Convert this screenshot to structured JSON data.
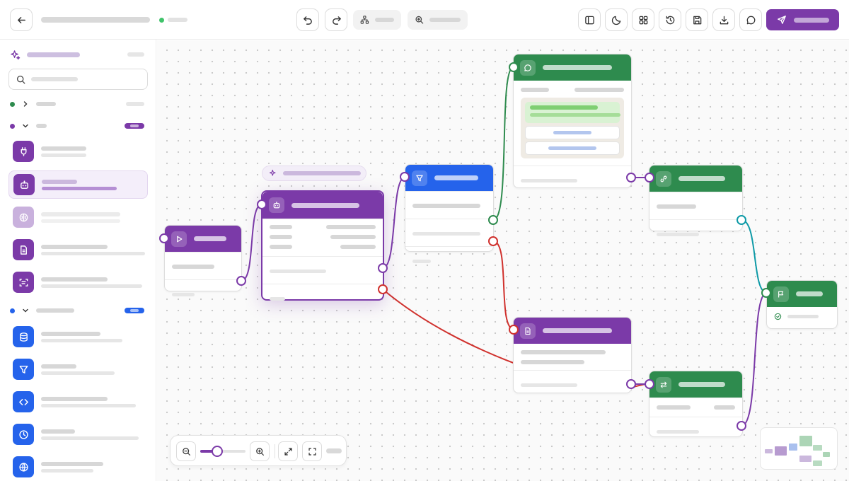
{
  "header": {
    "status_color": "#3fc36a",
    "back_icon": "arrow-left-icon",
    "undo_icon": "undo-icon",
    "redo_icon": "redo-icon",
    "layout_icon": "hierarchy-icon",
    "zoom_icon": "zoom-icon",
    "right_icons": [
      "sidebar-toggle-icon",
      "moon-icon",
      "grid-icon",
      "history-icon",
      "save-icon",
      "download-icon",
      "chat-icon"
    ],
    "publish_icon": "send-icon",
    "publish_color": "#7b3aa8"
  },
  "sidebar": {
    "brand_icon": "sparkles-icon",
    "search_icon": "search-icon",
    "groups": [
      {
        "color": "#2e8b4e",
        "state": "collapsed"
      },
      {
        "color": "#7b3aa8",
        "state": "expanded",
        "badge_color": "#7b3aa8",
        "items": [
          {
            "icon": "plug-icon",
            "color": "#7b3aa8"
          },
          {
            "icon": "bot-icon",
            "color": "#7b3aa8",
            "selected": true
          },
          {
            "icon": "brain-icon",
            "color": "#c9b1dd"
          },
          {
            "icon": "document-icon",
            "color": "#7b3aa8"
          },
          {
            "icon": "scan-text-icon",
            "color": "#7b3aa8"
          }
        ]
      },
      {
        "color": "#2563eb",
        "state": "expanded",
        "badge_color": "#2563eb",
        "items": [
          {
            "icon": "database-icon",
            "color": "#2563eb"
          },
          {
            "icon": "filter-icon",
            "color": "#2563eb"
          },
          {
            "icon": "code-icon",
            "color": "#2563eb"
          },
          {
            "icon": "clock-icon",
            "color": "#2563eb"
          },
          {
            "icon": "globe-icon",
            "color": "#2563eb"
          }
        ]
      }
    ]
  },
  "canvas": {
    "colors": {
      "purple": "#7b3aa8",
      "green": "#2e8b4e",
      "blue": "#2563eb",
      "red": "#d0312d",
      "teal": "#0e9aa7"
    },
    "annotation_icon": "sparkles-icon",
    "nodes": [
      {
        "id": "start",
        "icon": "play-icon",
        "color": "#7b3aa8"
      },
      {
        "id": "agent",
        "icon": "bot-icon",
        "color": "#7b3aa8"
      },
      {
        "id": "filter",
        "icon": "filter-icon",
        "color": "#2563eb"
      },
      {
        "id": "message",
        "icon": "chat-icon",
        "color": "#2e8b4e"
      },
      {
        "id": "tool",
        "icon": "link-icon",
        "color": "#2e8b4e"
      },
      {
        "id": "document",
        "icon": "document-icon",
        "color": "#7b3aa8"
      },
      {
        "id": "transform",
        "icon": "swap-icon",
        "color": "#2e8b4e"
      },
      {
        "id": "end",
        "icon": "flag-icon",
        "color": "#2e8b4e",
        "status_icon": "check-circle-icon"
      }
    ],
    "zoom_level": 0.3,
    "zoom_icons": [
      "zoom-out-icon",
      "zoom-in-icon",
      "expand-icon",
      "fit-screen-icon"
    ]
  }
}
